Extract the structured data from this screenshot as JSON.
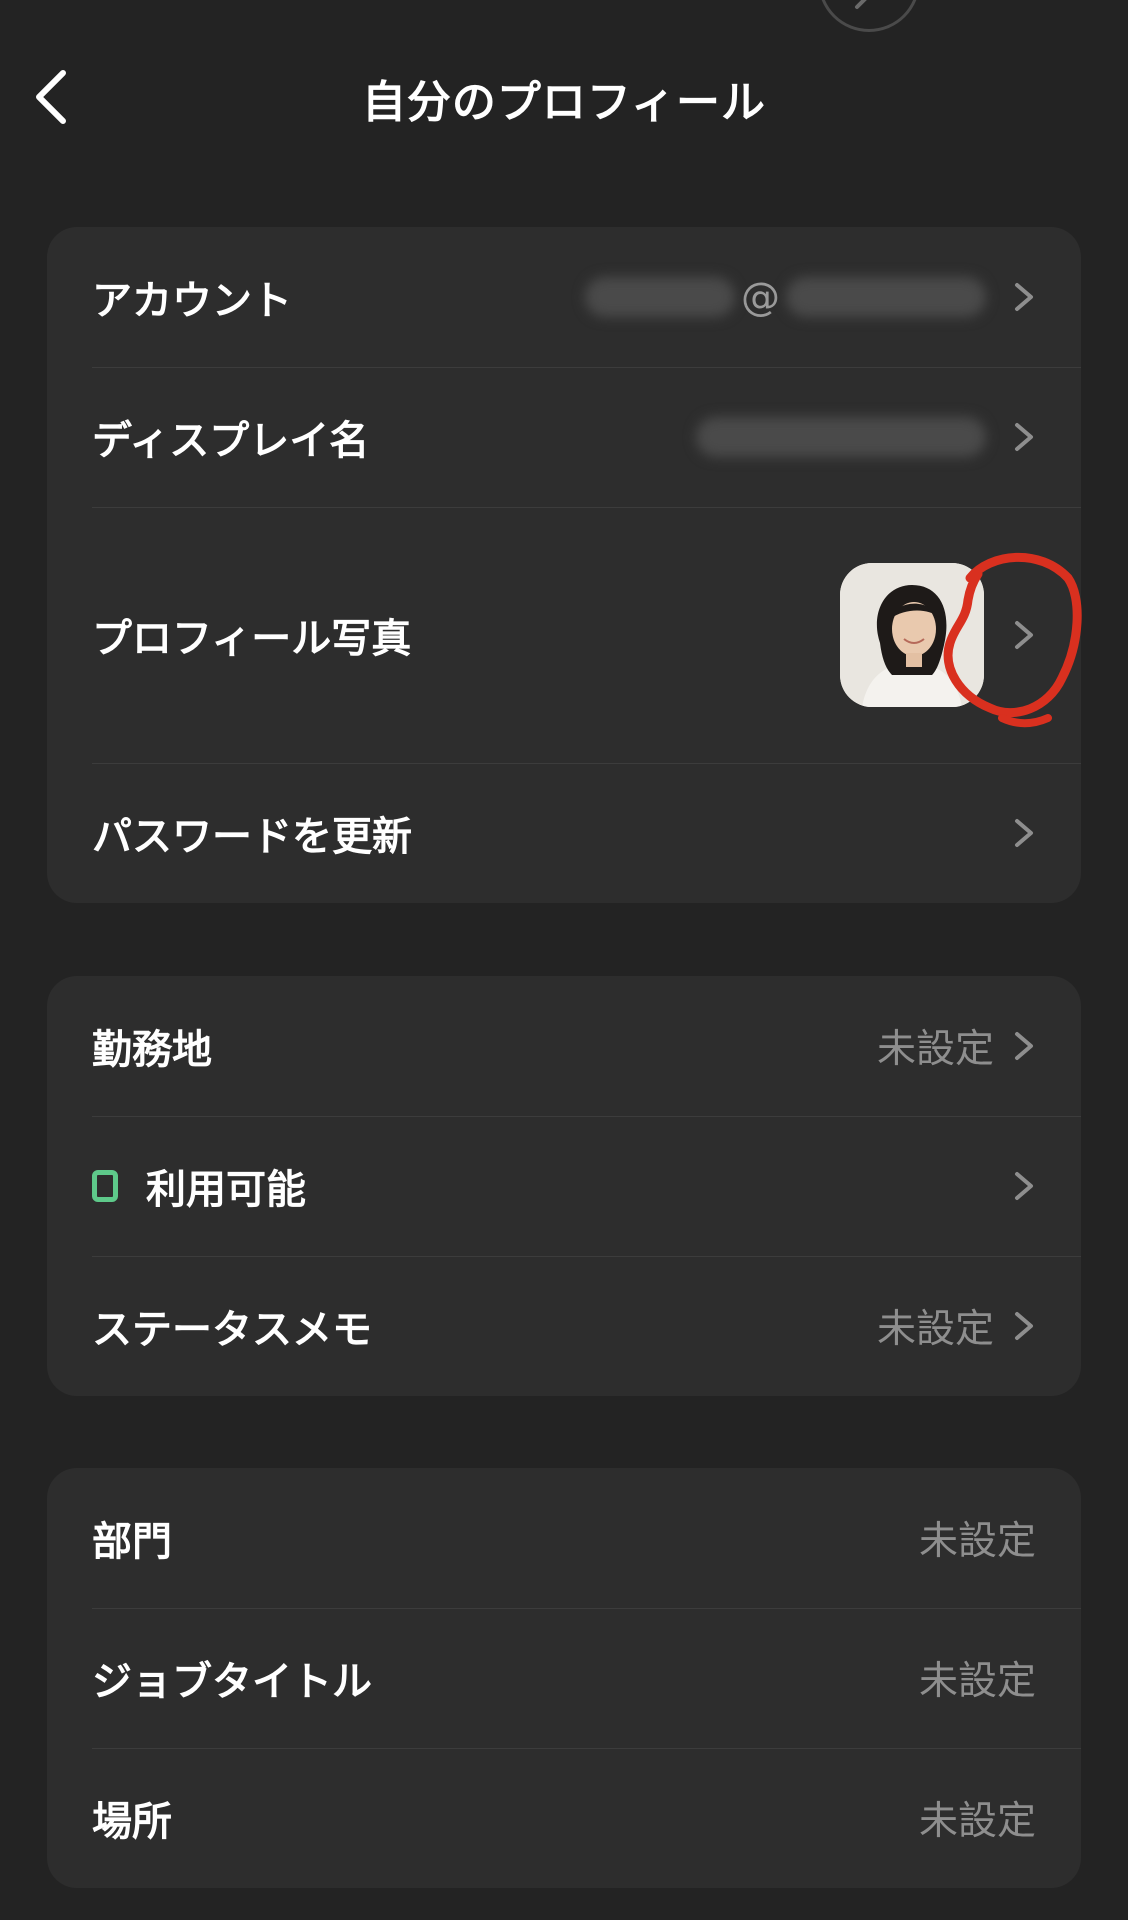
{
  "header": {
    "title": "自分のプロフィール"
  },
  "account_section": {
    "items": [
      {
        "label": "アカウント",
        "value": "@"
      },
      {
        "label": "ディスプレイ名"
      },
      {
        "label": "プロフィール写真"
      },
      {
        "label": "パスワードを更新"
      }
    ]
  },
  "status_section": {
    "items": [
      {
        "label": "勤務地",
        "value": "未設定"
      },
      {
        "label": "利用可能"
      },
      {
        "label": "ステータスメモ",
        "value": "未設定"
      }
    ]
  },
  "info_section": {
    "items": [
      {
        "label": "部門",
        "value": "未設定"
      },
      {
        "label": "ジョブタイトル",
        "value": "未設定"
      },
      {
        "label": "場所",
        "value": "未設定"
      }
    ]
  },
  "colors": {
    "background": "#232323",
    "card": "#2d2d2d",
    "text_primary": "#ffffff",
    "text_secondary": "#8e8e8e",
    "status_available": "#5ec98a",
    "annotation": "#d9301f"
  }
}
